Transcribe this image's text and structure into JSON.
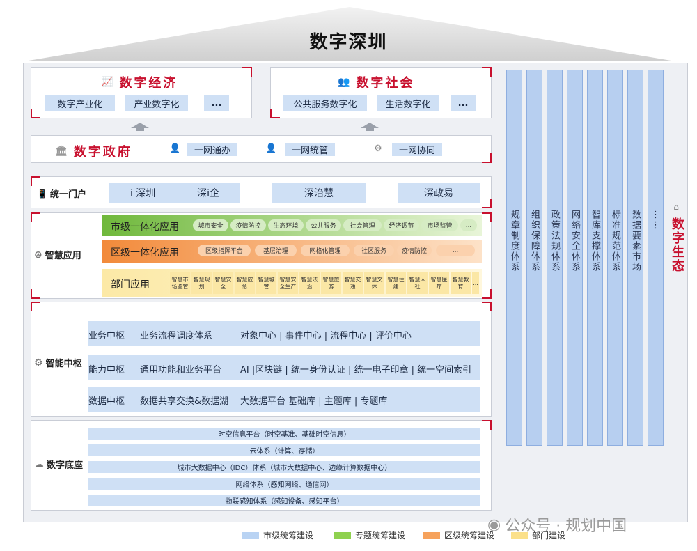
{
  "roof": {
    "title": "数字深圳"
  },
  "economy": {
    "title": "数字经济",
    "items": [
      "数字产业化",
      "产业数字化",
      "..."
    ]
  },
  "society": {
    "title": "数字社会",
    "items": [
      "公共服务数字化",
      "生活数字化",
      "..."
    ]
  },
  "government": {
    "title": "数字政府",
    "items": [
      "一网通办",
      "一网统管",
      "一网协同"
    ]
  },
  "portal": {
    "label": "统一门户",
    "items": [
      "i 深圳",
      "深i企",
      "深治慧",
      "深政易"
    ]
  },
  "smart_apps": {
    "label": "智慧应用",
    "city": {
      "title": "市级一体化应用",
      "chips": [
        "城市安全",
        "疫情防控",
        "生态环境",
        "公共服务",
        "社会管理",
        "经济调节",
        "市场监管",
        "..."
      ]
    },
    "district": {
      "title": "区级一体化应用",
      "chips": [
        "区级指挥平台",
        "基层治理",
        "网格化管理",
        "社区服务",
        "疫情防控",
        "..."
      ]
    },
    "dept": {
      "title": "部门应用",
      "chips": [
        "智慧市场监管",
        "智慧规划",
        "智慧安全",
        "智慧应急",
        "智慧城管",
        "智慧安全生产",
        "智慧法治",
        "智慧旅游",
        "智慧交通",
        "智慧文体",
        "智慧住建",
        "智慧人社",
        "智慧医疗",
        "智慧教育",
        "..."
      ]
    }
  },
  "smart_hub": {
    "label": "智能中枢",
    "rows": [
      {
        "name": "业务中枢",
        "a": "业务流程调度体系",
        "b": "对象中心 | 事件中心 | 流程中心 | 评价中心"
      },
      {
        "name": "能力中枢",
        "a": "通用功能和业务平台",
        "b": "AI |区块链 | 统一身份认证 | 统一电子印章 | 统一空间索引"
      },
      {
        "name": "数据中枢",
        "a": "数据共享交换&数据湖",
        "b": "大数据平台   基础库 | 主题库 | 专题库"
      }
    ]
  },
  "foundation": {
    "label": "数字底座",
    "rows": [
      "时空信息平台（时空基准、基础时空信息）",
      "云体系（计算、存储）",
      "城市大数据中心（IDC）体系（城市大数据中心、边缘计算数据中心）",
      "网络体系（感知网络、通信网）",
      "物联感知体系（感知设备、感知平台）"
    ]
  },
  "columns": [
    "规章制度体系",
    "组织保障体系",
    "政策法规体系",
    "网络安全体系",
    "智库支撑体系",
    "标准规范体系",
    "数据要素市场",
    "⋮⋮"
  ],
  "ecology": {
    "title": "数字生态"
  },
  "legend": [
    {
      "label": "市级统筹建设",
      "color": "#b9d3f3"
    },
    {
      "label": "专题统筹建设",
      "color": "#8fd14f"
    },
    {
      "label": "区级统筹建设",
      "color": "#f6a25c"
    },
    {
      "label": "部门建设",
      "color": "#fbe08a"
    }
  ],
  "watermark": "公众号 · 规划中国"
}
